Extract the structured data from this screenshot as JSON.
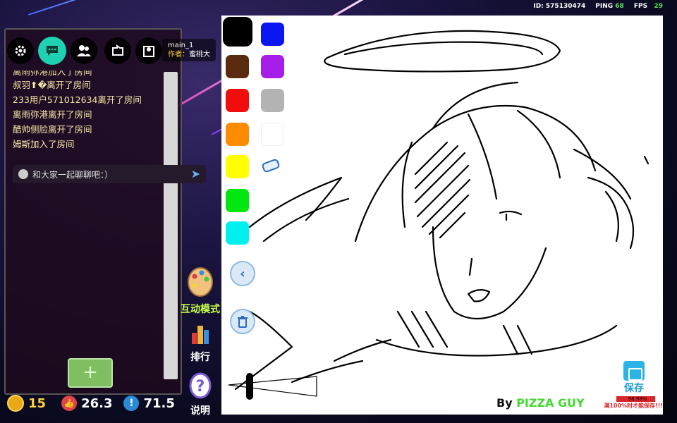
{
  "status": {
    "id_text": "ID: 575130474",
    "ping_label": "PING",
    "ping_value": "68",
    "fps_label": "FPS",
    "fps_value": "29"
  },
  "room": {
    "name": "main_1",
    "author_label": "作者：",
    "author_name": "蜜桃大"
  },
  "chat": {
    "messages": [
      "离雨弥港加入了房间",
      "叔羽⬆︎�离开了房间",
      "233用户571012634离开了房间",
      "离雨弥港离开了房间",
      "酷帅侧脸离开了房间",
      "姆斯加入了房间"
    ],
    "input_placeholder": "和大家一起聊聊吧：）",
    "add_label": "+"
  },
  "stats": {
    "coins": "15",
    "likes": "26.3",
    "reports": "71.5"
  },
  "side_buttons": {
    "interactive": "互动模式",
    "ranking": "排行",
    "help": "说明"
  },
  "palette": {
    "colors": [
      "#000000",
      "#0a17f0",
      "#5a2b0e",
      "#a61ce8",
      "#f20d0d",
      "#b3b3b3",
      "#ff8c00",
      "#ffffff",
      "#ffff00",
      "#ffffff",
      "#00e60f",
      "#ffffff",
      "#00f0f0"
    ],
    "selected": "#000000"
  },
  "canvas": {
    "credit_prefix": "By",
    "credit_name": "PIZZA GUY",
    "save_label": "保存",
    "progress_text": "98.98%",
    "progress_value": 0.9898,
    "warning": "满100%时才能保存!!!"
  }
}
